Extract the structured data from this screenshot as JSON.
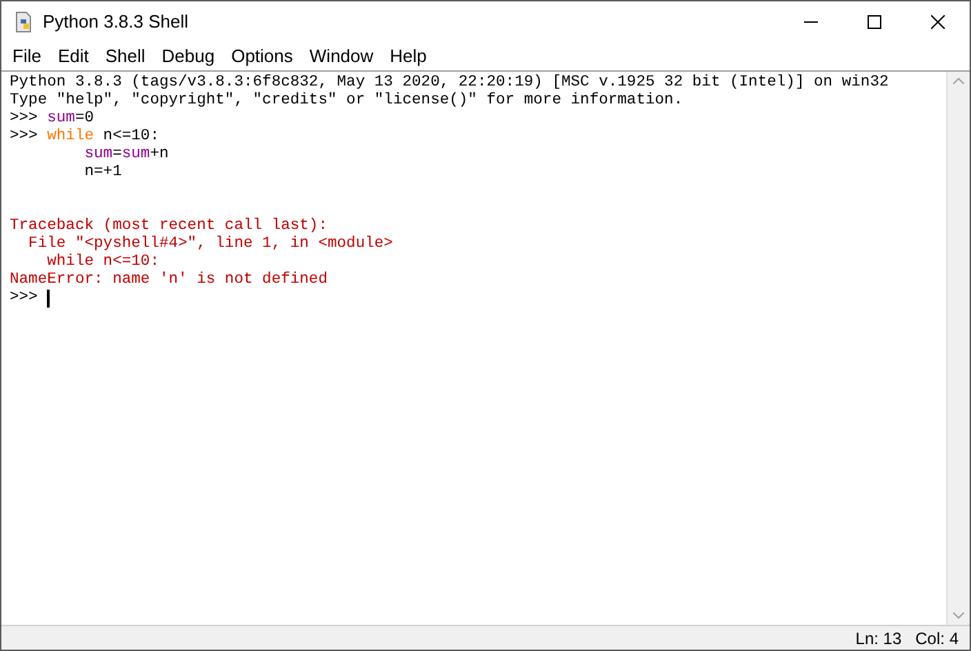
{
  "window": {
    "title": "Python 3.8.3 Shell"
  },
  "menu": [
    "File",
    "Edit",
    "Shell",
    "Debug",
    "Options",
    "Window",
    "Help"
  ],
  "shell_lines": [
    {
      "kind": "text",
      "segments": [
        {
          "text": "Python 3.8.3 (tags/v3.8.3:6f8c832, May 13 2020, 22:20:19) [MSC v.1925 32 bit (Intel)] on win32",
          "kind": "plain"
        }
      ]
    },
    {
      "kind": "text",
      "segments": [
        {
          "text": "Type \"help\", \"copyright\", \"credits\" or \"license()\" for more information.",
          "kind": "plain"
        }
      ]
    },
    {
      "kind": "text",
      "segments": [
        {
          "text": ">>> ",
          "kind": "prompt"
        },
        {
          "text": "sum",
          "kind": "builtin"
        },
        {
          "text": "=0",
          "kind": "plain"
        }
      ]
    },
    {
      "kind": "text",
      "segments": [
        {
          "text": ">>> ",
          "kind": "prompt"
        },
        {
          "text": "while",
          "kind": "keyword"
        },
        {
          "text": " n<=10:",
          "kind": "plain"
        }
      ]
    },
    {
      "kind": "text",
      "segments": [
        {
          "text": "\tsum",
          "kind": "builtin"
        },
        {
          "text": "=",
          "kind": "plain"
        },
        {
          "text": "sum",
          "kind": "builtin"
        },
        {
          "text": "+n",
          "kind": "plain"
        }
      ]
    },
    {
      "kind": "text",
      "segments": [
        {
          "text": "\tn=+1",
          "kind": "plain"
        }
      ]
    },
    {
      "kind": "blank"
    },
    {
      "kind": "blank"
    },
    {
      "kind": "text",
      "segments": [
        {
          "text": "Traceback (most recent call last):",
          "kind": "error"
        }
      ]
    },
    {
      "kind": "text",
      "segments": [
        {
          "text": "  File \"<pyshell#4>\", line 1, in <module>",
          "kind": "error"
        }
      ]
    },
    {
      "kind": "text",
      "segments": [
        {
          "text": "    while n<=10:",
          "kind": "error"
        }
      ]
    },
    {
      "kind": "text",
      "segments": [
        {
          "text": "NameError: name 'n' is not defined",
          "kind": "error"
        }
      ]
    },
    {
      "kind": "text",
      "cursor": true,
      "segments": [
        {
          "text": ">>> ",
          "kind": "prompt"
        }
      ]
    }
  ],
  "status_bar": {
    "line": "Ln: 13",
    "column": "Col: 4"
  }
}
